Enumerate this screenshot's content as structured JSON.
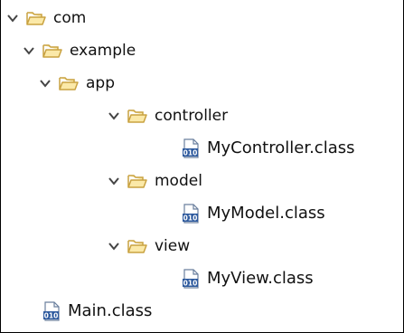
{
  "colors": {
    "folder_stroke": "#c9a240",
    "folder_fill": "#fbe9a8",
    "chevron": "#444444",
    "class_badge": "#2e5a9e",
    "class_paper": "#ffffff"
  },
  "tree": {
    "nodes": [
      {
        "name": "com",
        "type": "folder",
        "expanded": true,
        "icon": "folder-open-icon"
      },
      {
        "name": "example",
        "type": "folder",
        "expanded": true,
        "icon": "folder-open-icon"
      },
      {
        "name": "app",
        "type": "folder",
        "expanded": true,
        "icon": "folder-open-icon"
      },
      {
        "name": "controller",
        "type": "folder",
        "expanded": true,
        "icon": "folder-open-icon"
      },
      {
        "name": "MyController.class",
        "type": "class",
        "icon": "class-file-icon"
      },
      {
        "name": "model",
        "type": "folder",
        "expanded": true,
        "icon": "folder-open-icon"
      },
      {
        "name": "MyModel.class",
        "type": "class",
        "icon": "class-file-icon"
      },
      {
        "name": "view",
        "type": "folder",
        "expanded": true,
        "icon": "folder-open-icon"
      },
      {
        "name": "MyView.class",
        "type": "class",
        "icon": "class-file-icon"
      },
      {
        "name": "Main.class",
        "type": "class",
        "icon": "class-file-icon"
      }
    ],
    "class_badge_text": "010"
  }
}
